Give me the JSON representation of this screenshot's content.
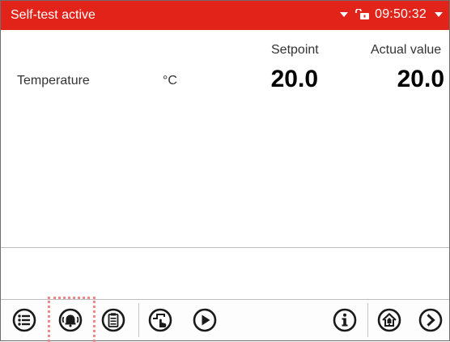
{
  "header": {
    "title": "Self-test active",
    "time": "09:50:32"
  },
  "table": {
    "columns": {
      "setpoint": "Setpoint",
      "actual": "Actual value"
    },
    "row": {
      "label": "Temperature",
      "unit": "°C",
      "setpoint": "20.0",
      "actual": "20.0"
    }
  },
  "footer": {
    "icons": [
      "menu-icon",
      "alarm-bell-icon",
      "clipboard-icon",
      "manual-mode-icon",
      "play-icon",
      "info-icon",
      "home-icon",
      "next-icon"
    ],
    "highlighted": "alarm-bell-icon"
  },
  "colors": {
    "header_bg": "#e2231a",
    "highlight_border": "#f08a8a"
  }
}
